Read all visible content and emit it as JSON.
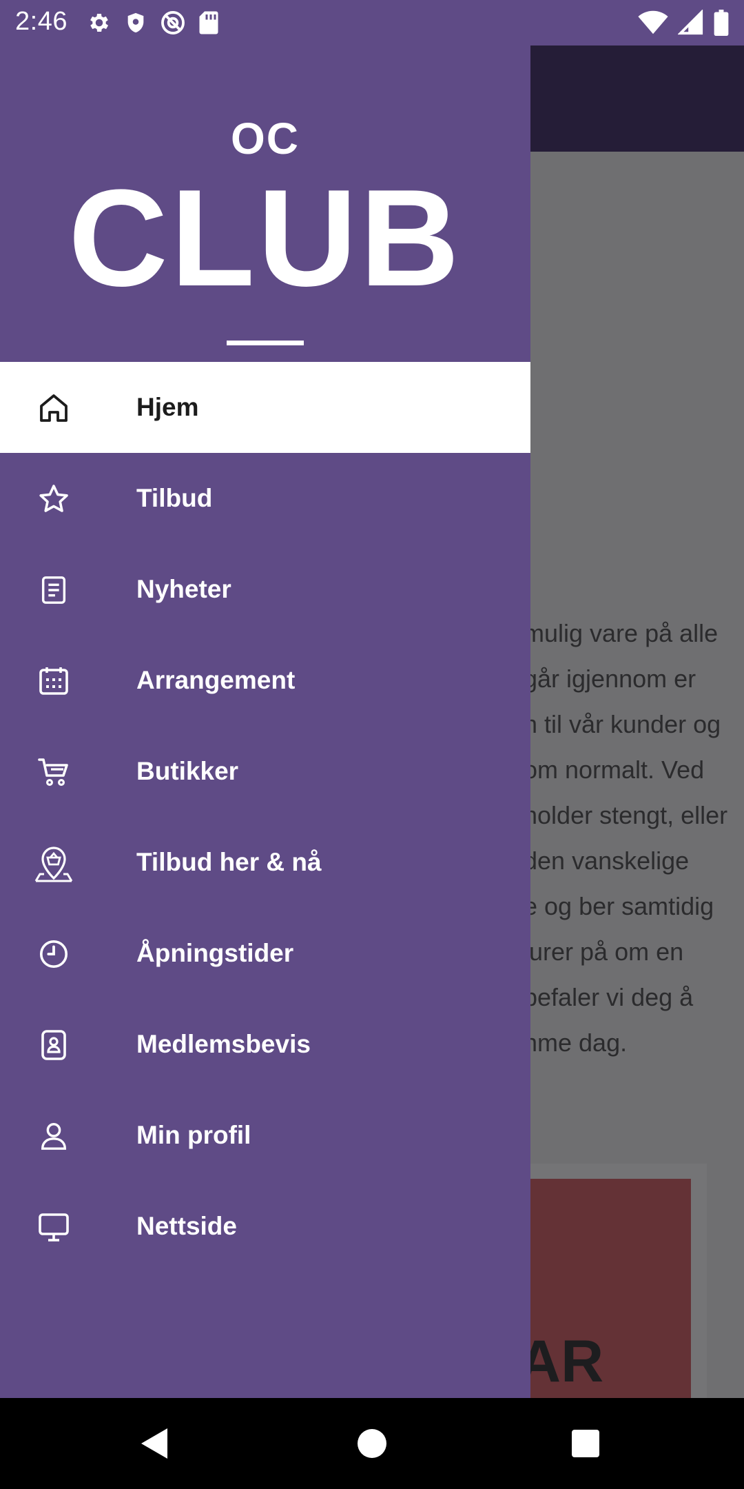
{
  "status_bar": {
    "time": "2:46",
    "left_icons": [
      "settings-icon",
      "shield-icon",
      "at-sign-icon",
      "sd-card-icon"
    ],
    "right_icons": [
      "wifi-icon",
      "signal-icon",
      "battery-icon"
    ]
  },
  "drawer": {
    "logo": {
      "top": "OC",
      "main": "CLUB"
    },
    "items": [
      {
        "label": "Hjem",
        "icon": "home-icon",
        "active": true
      },
      {
        "label": "Tilbud",
        "icon": "star-icon",
        "active": false
      },
      {
        "label": "Nyheter",
        "icon": "document-icon",
        "active": false
      },
      {
        "label": "Arrangement",
        "icon": "calendar-icon",
        "active": false
      },
      {
        "label": "Butikker",
        "icon": "cart-icon",
        "active": false
      },
      {
        "label": "Tilbud her & nå",
        "icon": "location-basket-icon",
        "active": false
      },
      {
        "label": "Åpningstider",
        "icon": "clock-icon",
        "active": false
      },
      {
        "label": "Medlemsbevis",
        "icon": "member-card-icon",
        "active": false
      },
      {
        "label": "Min profil",
        "icon": "user-icon",
        "active": false
      },
      {
        "label": "Nettside",
        "icon": "monitor-icon",
        "active": false
      }
    ]
  },
  "background_content": {
    "lines": [
      "mulig vare på alle",
      "går igjennom er",
      "n til vår kunder og",
      "om normalt. Ved",
      "holder stengt, eller",
      "den vanskelige",
      "e og ber samtidig",
      "lurer på om en",
      "befaler vi deg å",
      "nme dag."
    ],
    "card_text": "AR"
  },
  "nav_bar": {
    "buttons": [
      "back-icon",
      "home-circle-icon",
      "recents-icon"
    ]
  },
  "colors": {
    "drawer": "#5f4b86",
    "toolbar": "#251d37",
    "active_item": "#ffffff"
  }
}
